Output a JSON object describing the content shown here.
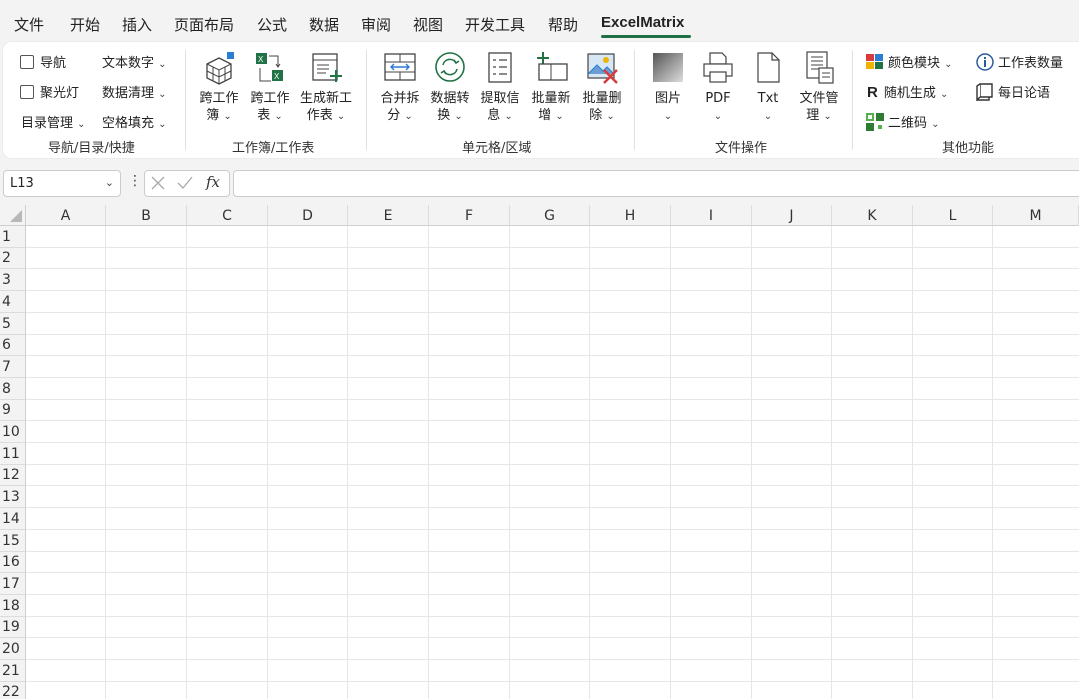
{
  "menu": {
    "items": [
      "文件",
      "开始",
      "插入",
      "页面布局",
      "公式",
      "数据",
      "审阅",
      "视图",
      "开发工具",
      "帮助",
      "ExcelMatrix"
    ],
    "active": "ExcelMatrix"
  },
  "ribbon": {
    "nav": {
      "nav_label": "导航",
      "spotlight_label": "聚光灯",
      "text_number_label": "文本数字",
      "data_clean_label": "数据清理",
      "toc_label": "目录管理",
      "fill_blank_label": "空格填充",
      "group_label": "导航/目录/快捷"
    },
    "workbook": {
      "cross_book_label": [
        "跨工作",
        "簿"
      ],
      "cross_sheet_label": [
        "跨工作",
        "表"
      ],
      "new_sheet_label": [
        "生成新工",
        "作表"
      ],
      "group_label": "工作簿/工作表"
    },
    "cells": {
      "merge_split_label": [
        "合并拆",
        "分"
      ],
      "convert_label": [
        "数据转",
        "换"
      ],
      "extract_label": [
        "提取信",
        "息"
      ],
      "batch_add_label": [
        "批量新",
        "增"
      ],
      "batch_delete_label": [
        "批量删",
        "除"
      ],
      "group_label": "单元格/区域"
    },
    "file": {
      "image_label": "图片",
      "pdf_label": "PDF",
      "txt_label": "Txt",
      "file_mgr_label": [
        "文件管",
        "理"
      ],
      "group_label": "文件操作"
    },
    "other": {
      "color_module_label": "颜色模块",
      "sheet_count_label": "工作表数量",
      "random_label": "随机生成",
      "daily_quote_label": "每日论语",
      "qr_label": "二维码",
      "group_label": "其他功能"
    }
  },
  "formula_bar": {
    "name_box": "L13",
    "fx": "fx",
    "formula": ""
  },
  "grid": {
    "columns": [
      "A",
      "B",
      "C",
      "D",
      "E",
      "F",
      "G",
      "H",
      "I",
      "J",
      "K",
      "L",
      "M"
    ],
    "rows": [
      "1",
      "2",
      "3",
      "4",
      "5",
      "6",
      "7",
      "8",
      "9",
      "10",
      "11",
      "12",
      "13",
      "14",
      "15",
      "16",
      "17",
      "18",
      "19",
      "20",
      "21",
      "22"
    ]
  },
  "colors": {
    "accent": "#1e7145",
    "excel_green": "#217346"
  }
}
